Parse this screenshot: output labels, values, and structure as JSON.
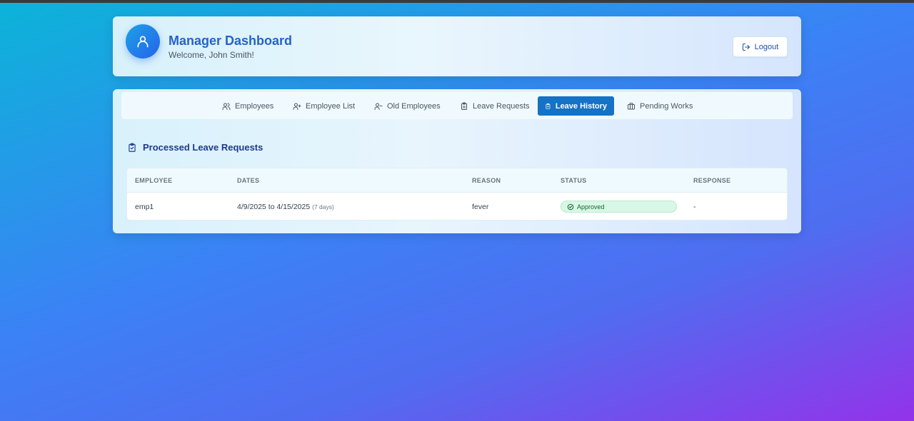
{
  "header": {
    "title": "Manager Dashboard",
    "welcome": "Welcome, John Smith!",
    "avatar_icon": "user-icon",
    "logout_label": "Logout",
    "logout_icon": "logout-icon"
  },
  "tabs": [
    {
      "label": "Employees",
      "icon": "users-icon",
      "active": false
    },
    {
      "label": "Employee List",
      "icon": "user-plus-icon",
      "active": false
    },
    {
      "label": "Old Employees",
      "icon": "user-minus-icon",
      "active": false
    },
    {
      "label": "Leave Requests",
      "icon": "clipboard-icon",
      "active": false
    },
    {
      "label": "Leave History",
      "icon": "clipboard-check-icon",
      "active": true
    },
    {
      "label": "Pending Works",
      "icon": "briefcase-icon",
      "active": false
    }
  ],
  "section": {
    "title": "Processed Leave Requests",
    "icon": "clipboard-check-icon"
  },
  "table": {
    "columns": [
      "EMPLOYEE",
      "DATES",
      "REASON",
      "STATUS",
      "RESPONSE"
    ],
    "rows": [
      {
        "employee": "emp1",
        "dates": "4/9/2025 to 4/15/2025",
        "days": "(7 days)",
        "reason": "fever",
        "status": "Approved",
        "response": "-"
      }
    ]
  },
  "colors": {
    "accent": "#1572c5",
    "title": "#2563c9",
    "approved_bg": "#d9f7e6",
    "approved_text": "#166534"
  }
}
